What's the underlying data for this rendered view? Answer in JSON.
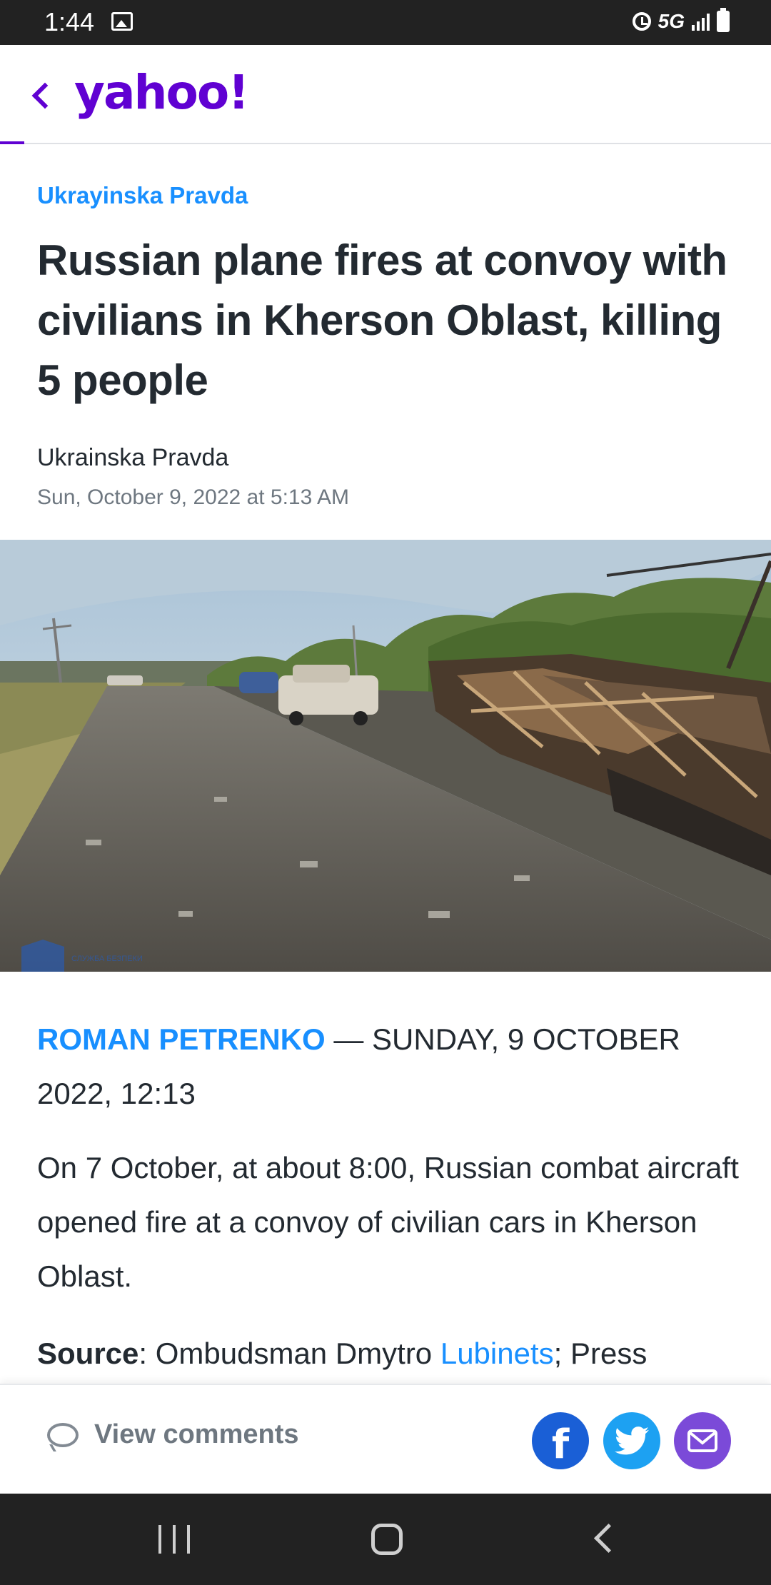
{
  "status_bar": {
    "time": "1:44",
    "network": "5G",
    "icons": [
      "gallery-icon",
      "alarm-icon",
      "signal-icon",
      "battery-icon"
    ]
  },
  "header": {
    "logo": "yahoo!",
    "brand_color": "#6001d2"
  },
  "article": {
    "provider": "Ukrayinska Pravda",
    "title": "Russian plane fires at convoy with civilians in Kherson Oblast, killing 5 people",
    "author": "Ukrainska Pravda",
    "date": "Sun, October 9, 2022 at 5:13 AM",
    "image_watermark": "СЛУЖБА БЕЗПЕКИ",
    "byline_author": "ROMAN PETRENKO",
    "byline_separator": " — ",
    "byline_date": "SUNDAY, 9 OCTOBER 2022, 12:13",
    "paragraph1": "On 7 October, at about 8:00, Russian combat aircraft opened fire at a convoy of civilian cars in Kherson Oblast.",
    "paragraph2_label": "Source",
    "paragraph2_text": ": Ombudsman Dmytro ",
    "paragraph2_link": "Lubinets",
    "paragraph2_after": "; Press"
  },
  "bottom_bar": {
    "view_comments": "View comments",
    "share_buttons": [
      "facebook-icon",
      "twitter-icon",
      "mail-icon"
    ],
    "colors": {
      "facebook": "#1a5fd6",
      "twitter": "#1da1f2",
      "mail": "#7b4ad8"
    }
  },
  "colors": {
    "link": "#188fff",
    "text": "#232a31",
    "muted": "#6e7780"
  }
}
